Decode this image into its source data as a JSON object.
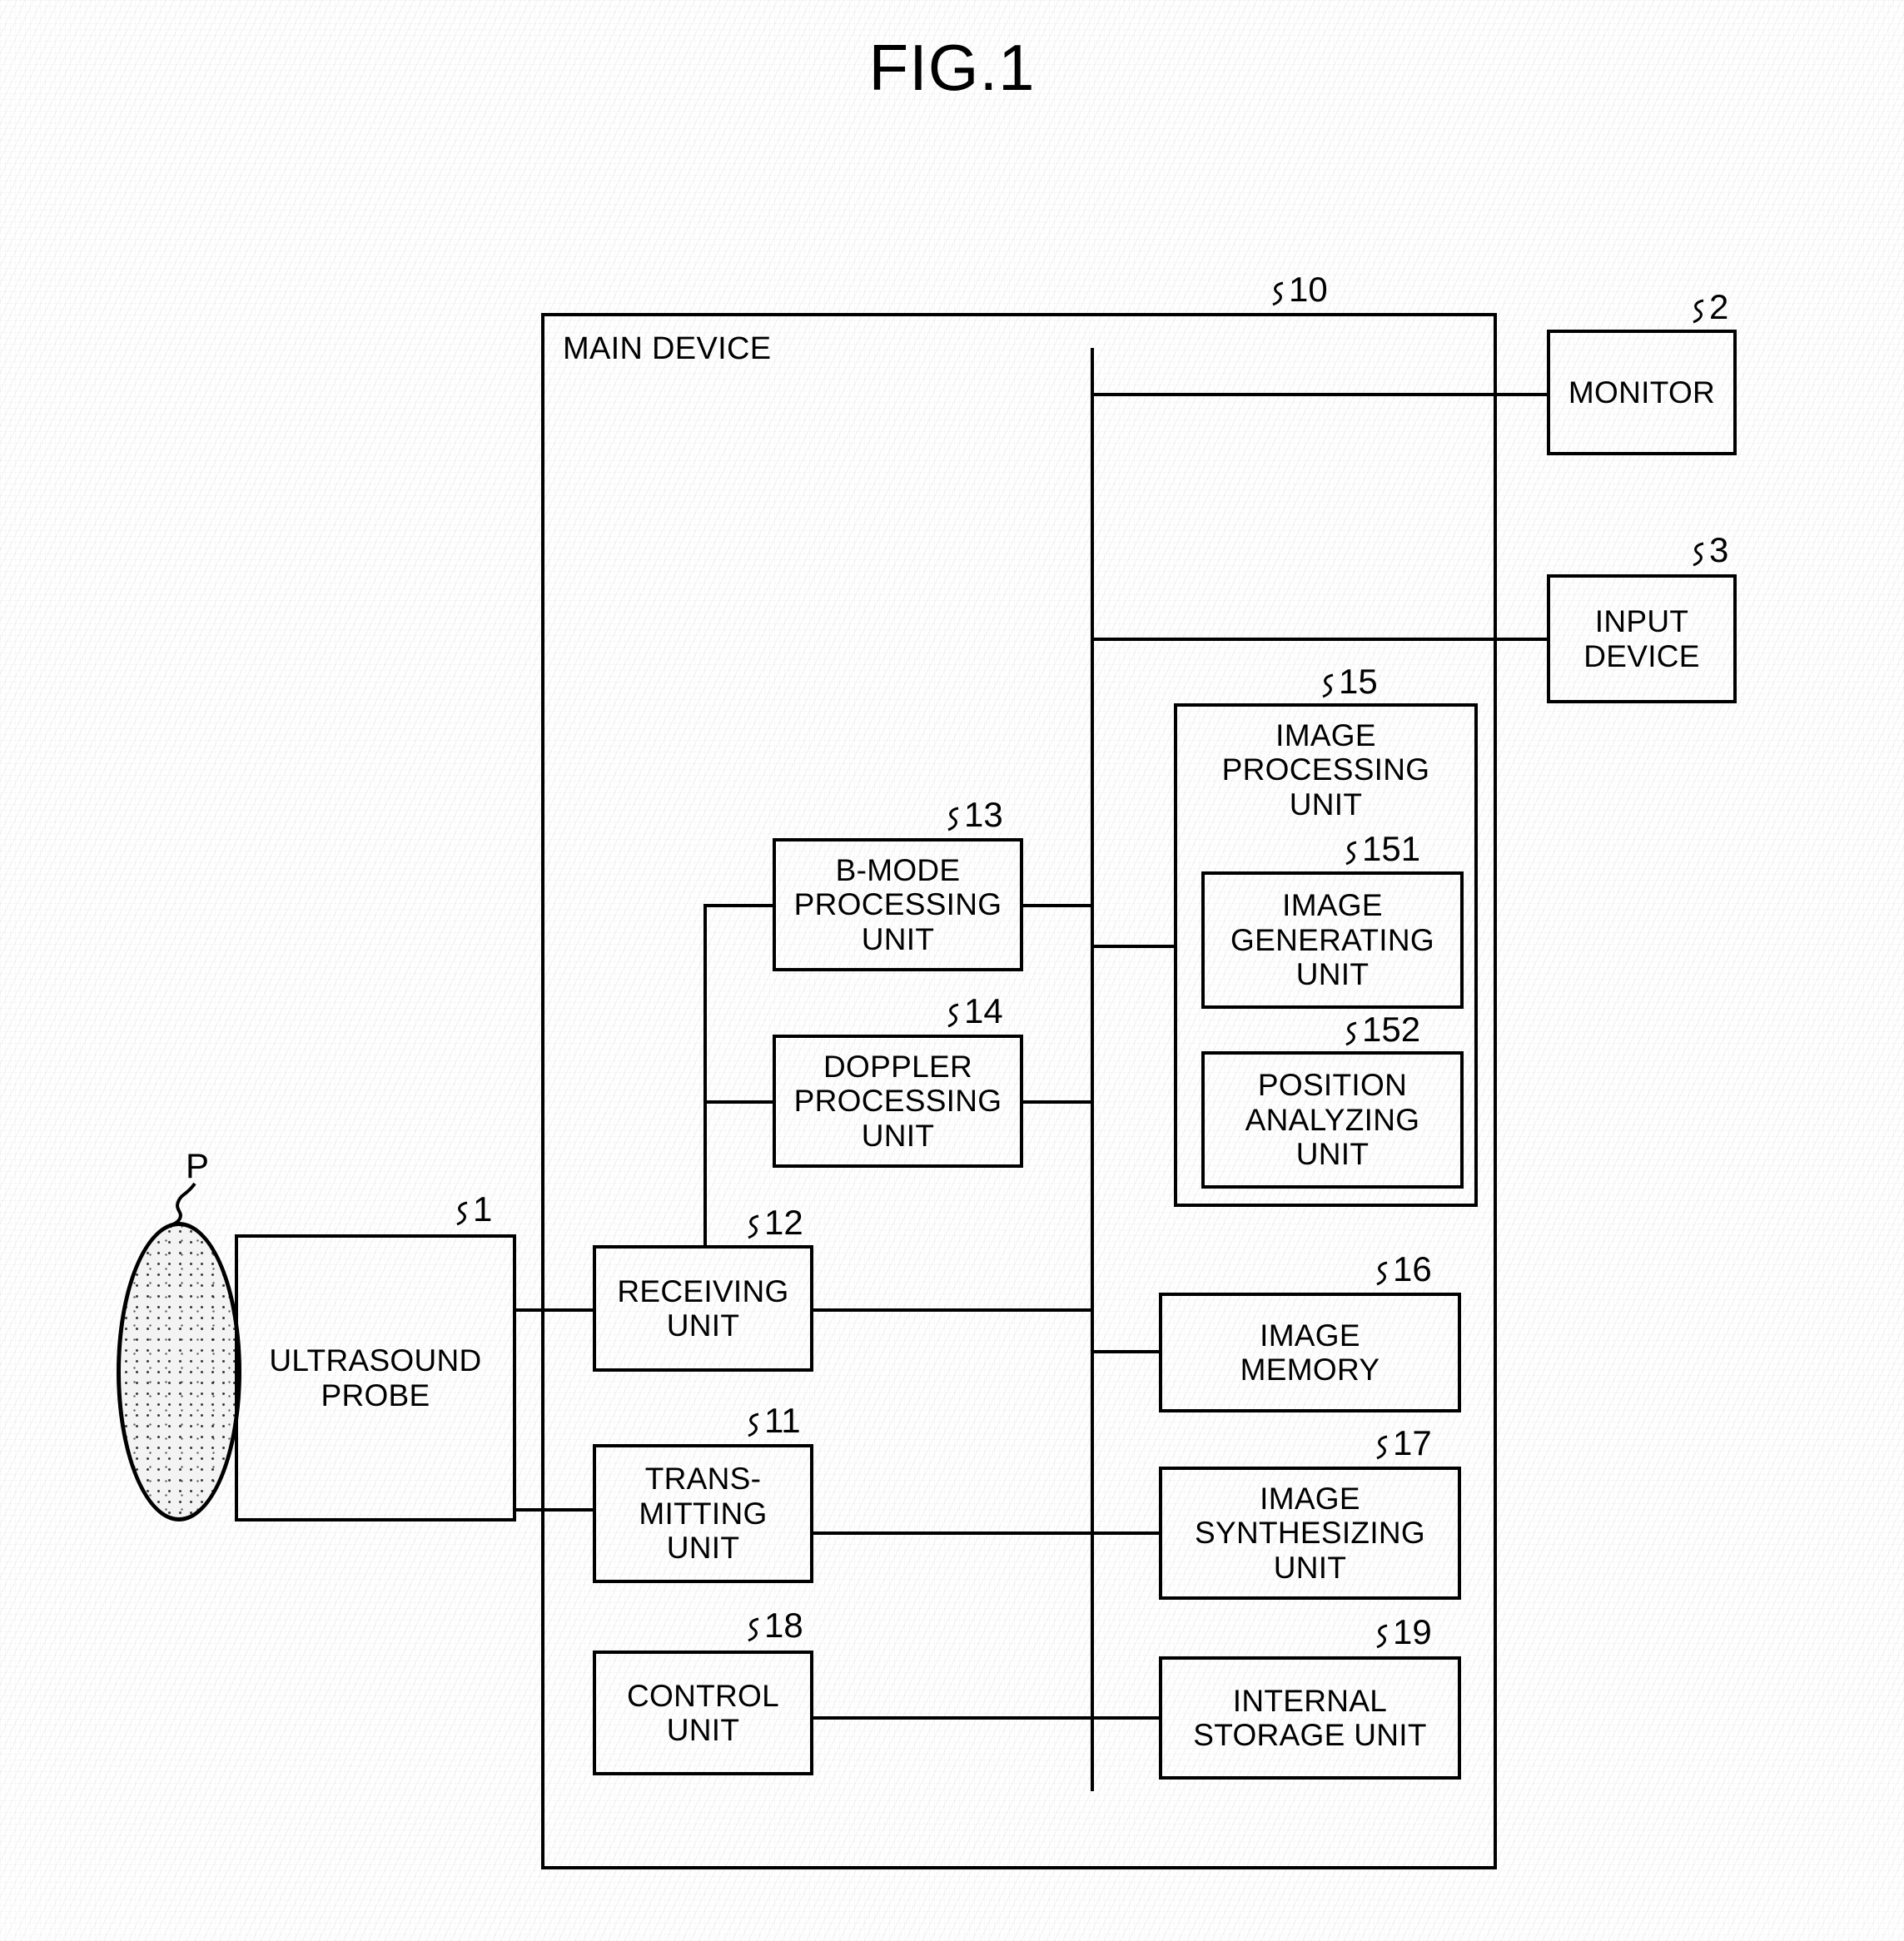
{
  "figure": {
    "title": "FIG.1",
    "caption_domain": "ultrasound diagnostic apparatus block diagram"
  },
  "labels": {
    "patient": "P",
    "main_device": "MAIN DEVICE"
  },
  "refs": {
    "main_device": "10",
    "ultrasound_probe": "1",
    "monitor": "2",
    "input_device": "3",
    "transmitting_unit": "11",
    "receiving_unit": "12",
    "b_mode_processing_unit": "13",
    "doppler_processing_unit": "14",
    "image_processing_unit": "15",
    "image_generating_unit": "151",
    "position_analyzing_unit": "152",
    "image_memory": "16",
    "image_synthesizing_unit": "17",
    "control_unit": "18",
    "internal_storage_unit": "19"
  },
  "blocks": {
    "ultrasound_probe": "ULTRASOUND\nPROBE",
    "monitor": "MONITOR",
    "input_device": "INPUT\nDEVICE",
    "b_mode_processing_unit": "B-MODE\nPROCESSING\nUNIT",
    "doppler_processing_unit": "DOPPLER\nPROCESSING\nUNIT",
    "image_processing_unit": "IMAGE\nPROCESSING\nUNIT",
    "image_generating_unit": "IMAGE\nGENERATING\nUNIT",
    "position_analyzing_unit": "POSITION\nANALYZING\nUNIT",
    "receiving_unit": "RECEIVING\nUNIT",
    "transmitting_unit": "TRANS-\nMITTING\nUNIT",
    "control_unit": "CONTROL\nUNIT",
    "image_memory": "IMAGE\nMEMORY",
    "image_synthesizing_unit": "IMAGE\nSYNTHESIZING\nUNIT",
    "internal_storage_unit": "INTERNAL\nSTORAGE UNIT"
  },
  "colors": {
    "ink": "#000000",
    "paper": "#ffffff"
  }
}
